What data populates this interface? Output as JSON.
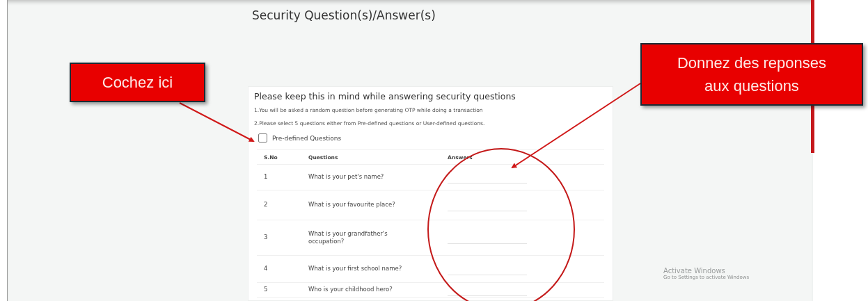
{
  "page": {
    "title": "Security Question(s)/Answer(s)"
  },
  "notice": {
    "heading": "Please keep this in mind while answering security questions",
    "lines": [
      "1.You will be asked a random question before generating OTP while doing a transaction",
      "2.Please select 5 questions either from Pre-defined questions or User-defined questions."
    ]
  },
  "predefined_option": {
    "label": "Pre-defined Questions",
    "checked": false
  },
  "table": {
    "columns": [
      "S.No",
      "Questions",
      "Answers"
    ],
    "rows": [
      {
        "number": "1",
        "question": "What is your pet's name?"
      },
      {
        "number": "2",
        "question": "What is your favourite place?"
      },
      {
        "number": "3",
        "question": "What is your grandfather's occupation?"
      },
      {
        "number": "4",
        "question": "What is your first school name?"
      },
      {
        "number": "5",
        "question": "Who is your childhood hero?"
      }
    ]
  },
  "callouts": [
    "Cochez ici",
    "Donnez des reponses aux questions"
  ],
  "os_notice": {
    "title": "Activate Windows",
    "subtitle": "Go to Settings to activate Windows"
  }
}
